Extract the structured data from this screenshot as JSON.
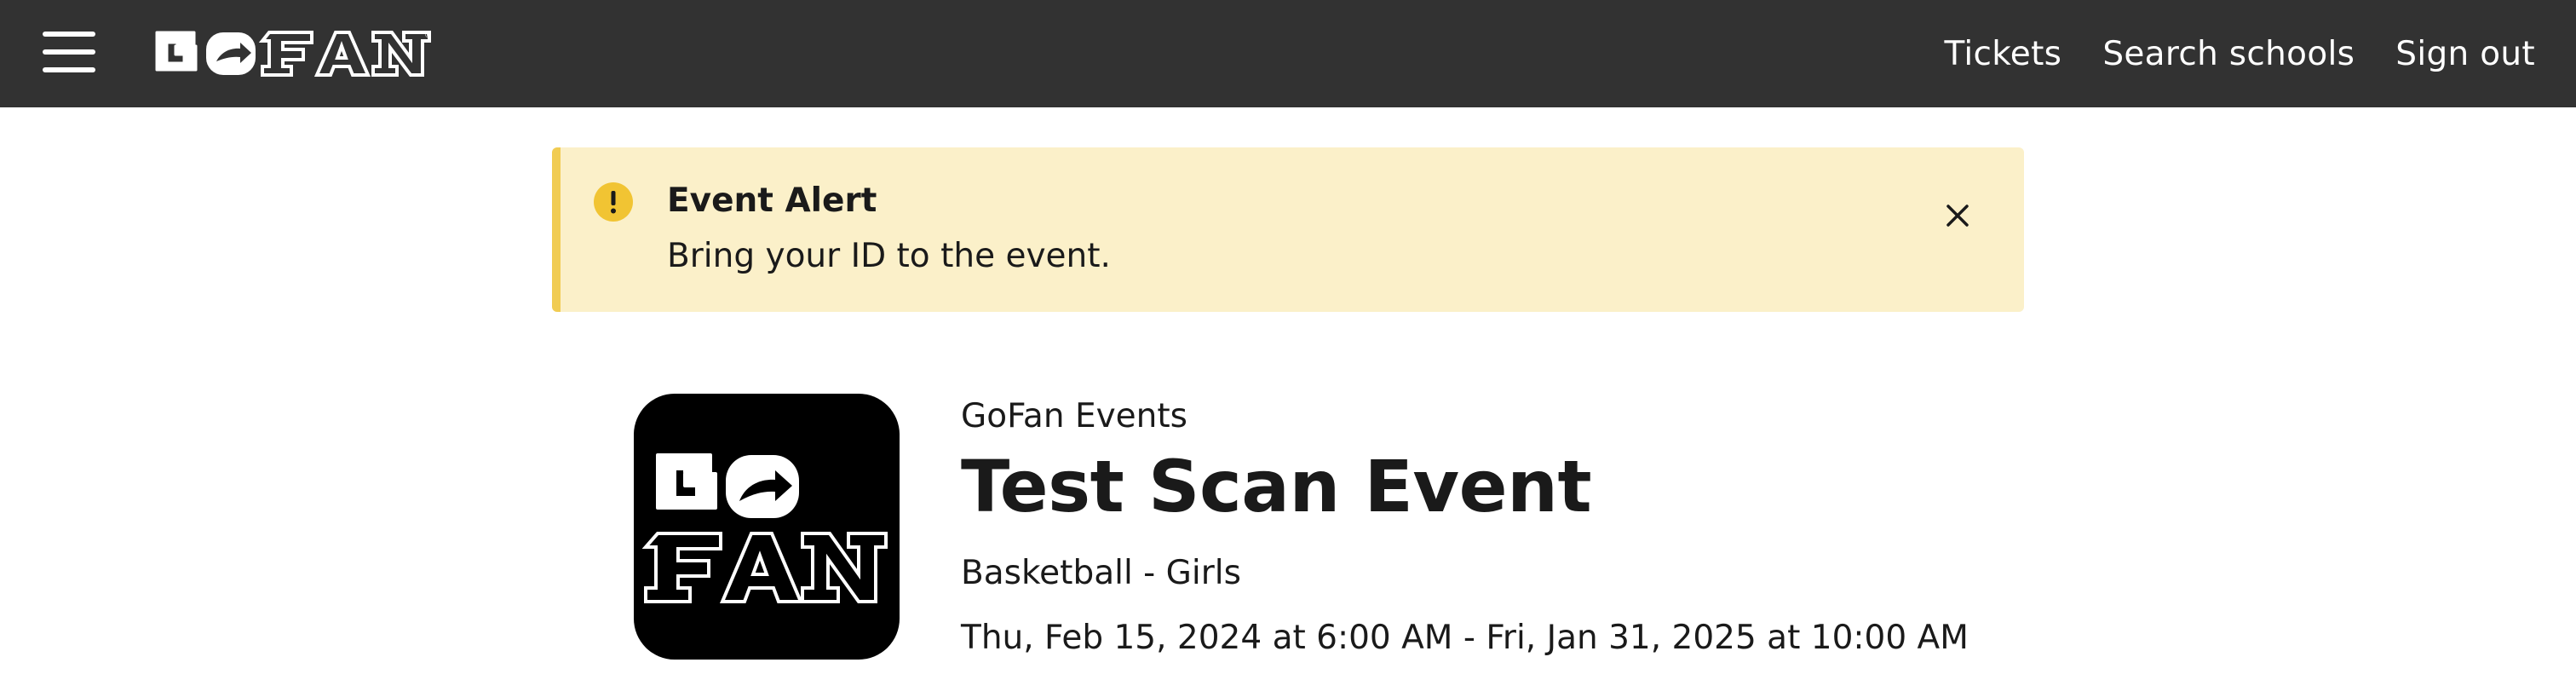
{
  "header": {
    "menu_icon": "hamburger-menu-icon",
    "brand": "GOFAN",
    "nav": [
      {
        "label": "Tickets"
      },
      {
        "label": "Search schools"
      },
      {
        "label": "Sign out"
      }
    ],
    "colors": {
      "background": "#323232",
      "text": "#ffffff"
    }
  },
  "alert": {
    "icon": "exclamation-circle-icon",
    "title": "Event Alert",
    "message": "Bring your ID to the event.",
    "close_icon": "close-icon",
    "colors": {
      "background": "#fbf0c9",
      "accent": "#f1cc52"
    }
  },
  "event": {
    "logo": "GO FAN",
    "organization": "GoFan Events",
    "title": "Test Scan Event",
    "sport": "Basketball - Girls",
    "dates": "Thu, Feb 15, 2024 at 6:00 AM - Fri, Jan 31, 2025 at 10:00 AM"
  }
}
